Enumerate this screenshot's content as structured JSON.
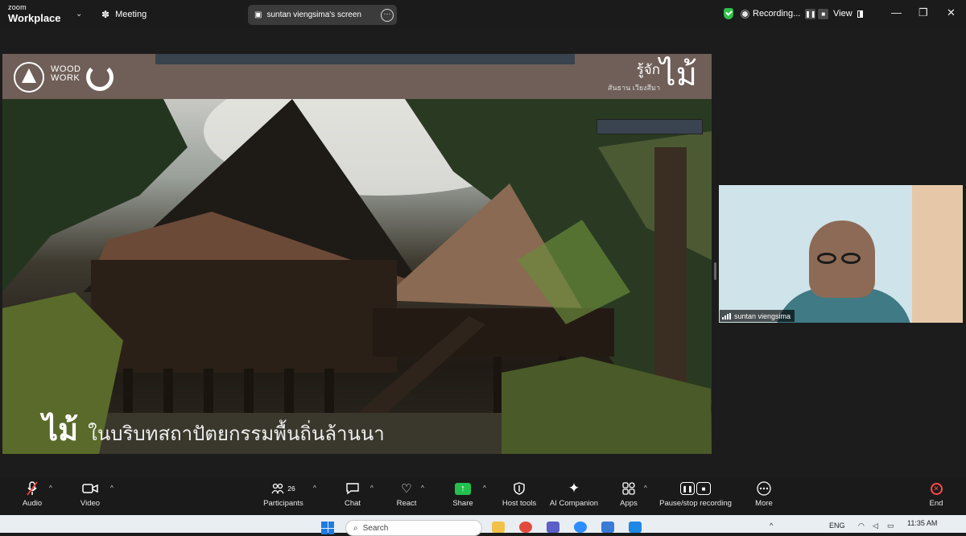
{
  "app": {
    "brand_top": "zoom",
    "brand_bottom": "Workplace",
    "meeting_label": "Meeting"
  },
  "share_pill": {
    "label": "suntan viengsima's screen"
  },
  "recording": {
    "label": "Recording...",
    "pause_icon": "pause-icon",
    "stop_icon": "stop-icon"
  },
  "view": {
    "label": "View"
  },
  "window_controls": {
    "minimize": "—",
    "restore": "❐",
    "close": "✕"
  },
  "slide": {
    "logo_text_line1": "WOOD",
    "logo_text_line2": "WORK",
    "tag_main": "รู้จัก",
    "tag_sub": "สันธาน เวียงสีมา",
    "tag_big": "ไม้",
    "caption_big": "ไม้",
    "caption_rest": "ในบริบทสถาปัตยกรรมพื้นถิ่นล้านนา"
  },
  "participant": {
    "name": "suntan viengsima"
  },
  "controls": {
    "audio": "Audio",
    "video": "Video",
    "participants": "Participants",
    "participants_count": "26",
    "chat": "Chat",
    "react": "React",
    "share": "Share",
    "host_tools": "Host tools",
    "ai_companion": "AI Companion",
    "apps": "Apps",
    "pause_stop": "Pause/stop recording",
    "more": "More",
    "end": "End"
  },
  "taskbar": {
    "search_placeholder": "Search",
    "lang": "ENG",
    "time": "11:35 AM"
  },
  "colors": {
    "share_green": "#23c04f",
    "end_red": "#ff4a4a",
    "shield_green": "#2fbf4a"
  }
}
